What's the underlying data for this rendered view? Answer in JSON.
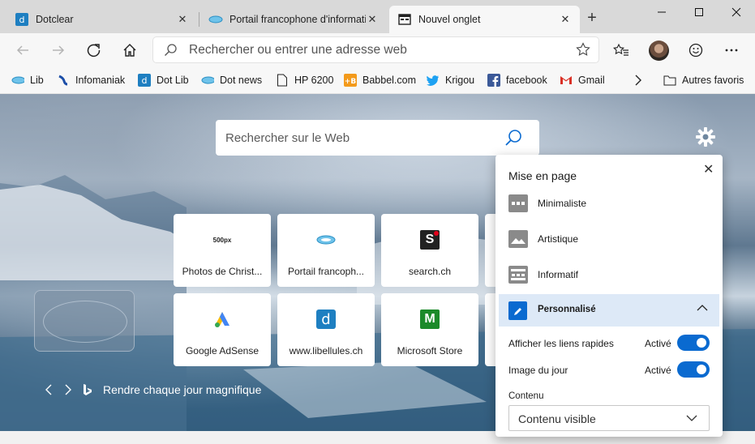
{
  "tabs": [
    {
      "label": "Dotclear",
      "icon": "dotclear-icon",
      "active": false
    },
    {
      "label": "Portail francophone d'informatio",
      "icon": "libellules-icon",
      "active": false
    },
    {
      "label": "Nouvel onglet",
      "icon": "newtab-page-icon",
      "active": true
    }
  ],
  "address_bar": {
    "placeholder": "Rechercher ou entrer une adresse web"
  },
  "bookmarks": [
    {
      "label": "Lib",
      "icon": "libellules-icon"
    },
    {
      "label": "Infomaniak",
      "icon": "infomaniak-icon"
    },
    {
      "label": "Dot Lib",
      "icon": "dotclear-icon"
    },
    {
      "label": "Dot news",
      "icon": "libellules-icon"
    },
    {
      "label": "HP 6200",
      "icon": "page-icon"
    },
    {
      "label": "Babbel.com",
      "icon": "babbel-icon"
    },
    {
      "label": "Krigou",
      "icon": "twitter-icon"
    },
    {
      "label": "facebook",
      "icon": "facebook-icon"
    },
    {
      "label": "Gmail",
      "icon": "gmail-icon"
    }
  ],
  "other_favorites": "Autres favoris",
  "web_search": {
    "placeholder": "Rechercher sur le Web"
  },
  "quick_links": [
    {
      "label": "Photos de Christ...",
      "icon": "500px-icon",
      "icon_text": "500px"
    },
    {
      "label": "Portail francoph...",
      "icon": "libellules-icon",
      "icon_text": ""
    },
    {
      "label": "search.ch",
      "icon": "search-ch-icon",
      "icon_text": "S"
    },
    {
      "label": "Google AdSense",
      "icon": "adsense-icon",
      "icon_text": ""
    },
    {
      "label": "www.libellules.ch",
      "icon": "libellules-d-icon",
      "icon_text": "d"
    },
    {
      "label": "Microsoft Store",
      "icon": "microsoft-store-icon",
      "icon_text": "M"
    }
  ],
  "daily_image_text": "Rendre chaque jour magnifique",
  "layout_panel": {
    "title": "Mise en page",
    "options": [
      {
        "label": "Minimaliste",
        "icon": "minimal-layout-icon"
      },
      {
        "label": "Artistique",
        "icon": "artistic-layout-icon"
      },
      {
        "label": "Informatif",
        "icon": "informative-layout-icon"
      }
    ],
    "custom": {
      "label": "Personnalisé",
      "icon": "custom-pencil-icon"
    },
    "toggles": [
      {
        "label": "Afficher les liens rapides",
        "state": "Activé",
        "on": true
      },
      {
        "label": "Image du jour",
        "state": "Activé",
        "on": true
      }
    ],
    "content_label": "Contenu",
    "content_value": "Contenu visible"
  },
  "colors": {
    "accent": "#0a6ad0",
    "titlebar": "#d9d9d9",
    "toolbar": "#f7f7f7"
  }
}
